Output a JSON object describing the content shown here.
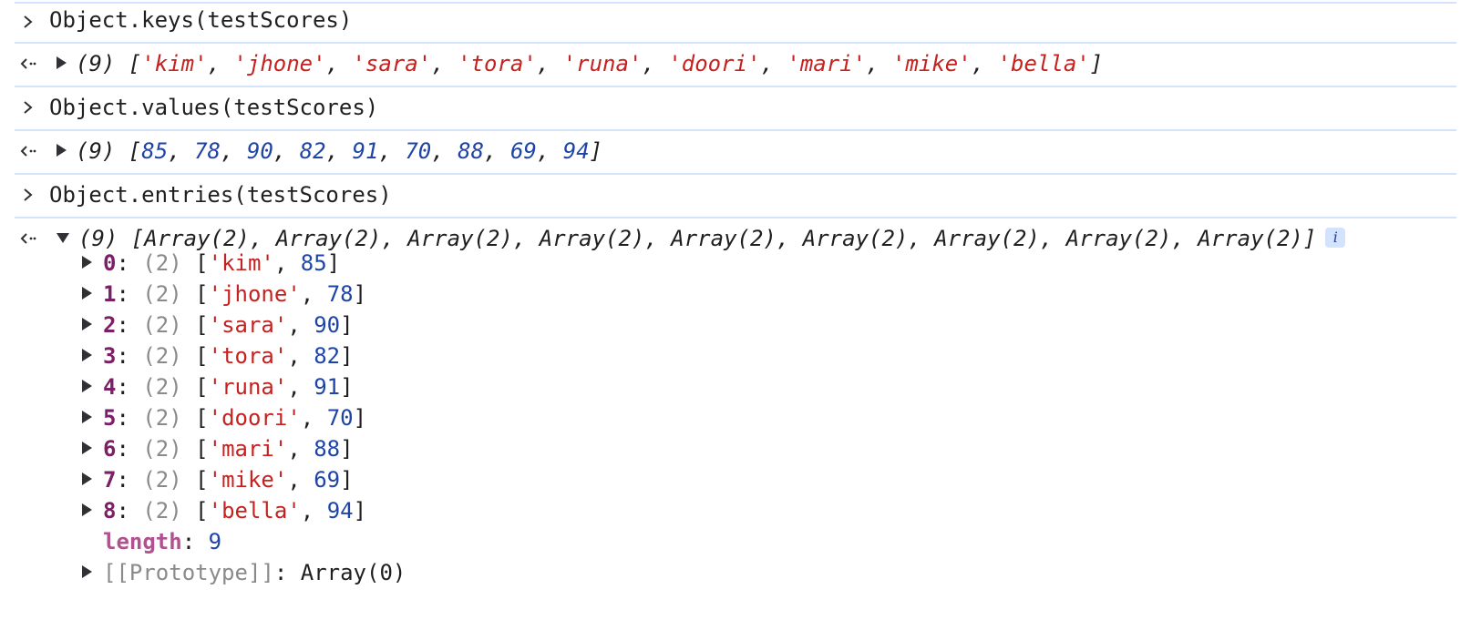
{
  "commands": [
    {
      "input": "Object.keys(testScores)",
      "output_count": "(9)",
      "output_items": [
        "'kim'",
        "'jhone'",
        "'sara'",
        "'tora'",
        "'runa'",
        "'doori'",
        "'mari'",
        "'mike'",
        "'bella'"
      ]
    },
    {
      "input": "Object.values(testScores)",
      "output_count": "(9)",
      "output_items": [
        "85",
        "78",
        "90",
        "82",
        "91",
        "70",
        "88",
        "69",
        "94"
      ]
    },
    {
      "input": "Object.entries(testScores)",
      "output_count": "(9)",
      "output_summary_item": "Array(2)",
      "info_badge": "i",
      "entries": [
        {
          "index": "0",
          "count": "(2)",
          "name": "'kim'",
          "score": "85"
        },
        {
          "index": "1",
          "count": "(2)",
          "name": "'jhone'",
          "score": "78"
        },
        {
          "index": "2",
          "count": "(2)",
          "name": "'sara'",
          "score": "90"
        },
        {
          "index": "3",
          "count": "(2)",
          "name": "'tora'",
          "score": "82"
        },
        {
          "index": "4",
          "count": "(2)",
          "name": "'runa'",
          "score": "91"
        },
        {
          "index": "5",
          "count": "(2)",
          "name": "'doori'",
          "score": "70"
        },
        {
          "index": "6",
          "count": "(2)",
          "name": "'mari'",
          "score": "88"
        },
        {
          "index": "7",
          "count": "(2)",
          "name": "'mike'",
          "score": "69"
        },
        {
          "index": "8",
          "count": "(2)",
          "name": "'bella'",
          "score": "94"
        }
      ],
      "length_label": "length",
      "length_value": "9",
      "prototype_label": "[[Prototype]]",
      "prototype_value": "Array(0)"
    }
  ],
  "icons": {
    "input_prompt": "chevron-right-icon",
    "output_prompt": "return-arrow-icon",
    "expand": "triangle-right-icon",
    "collapse": "triangle-down-icon"
  },
  "colors": {
    "string": "#c5221f",
    "number": "#1f44a8",
    "key": "#7b1f66",
    "separator": "#d3e3fd"
  }
}
